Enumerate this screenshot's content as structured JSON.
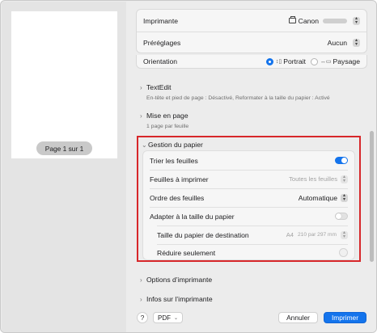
{
  "preview": {
    "page_indicator": "Page 1 sur 1"
  },
  "printer_card": {
    "printer_label": "Imprimante",
    "printer_value": "Canon",
    "presets_label": "Préréglages",
    "presets_value": "Aucun"
  },
  "orientation": {
    "label": "Orientation",
    "portrait": "Portrait",
    "landscape": "Paysage",
    "selected": "Portrait"
  },
  "sections": {
    "textedit": {
      "title": "TextEdit",
      "summary": "En-tête et pied de page : Désactivé, Reformater à la taille du papier : Activé"
    },
    "layout": {
      "title": "Mise en page",
      "summary": "1 page par feuille"
    },
    "paper_handling": {
      "title": "Gestion du papier",
      "collate_label": "Trier les feuilles",
      "collate_on": true,
      "pages_to_print_label": "Feuilles à imprimer",
      "pages_to_print_value": "Toutes les feuilles",
      "page_order_label": "Ordre des feuilles",
      "page_order_value": "Automatique",
      "scale_to_fit_label": "Adapter à la taille du papier",
      "scale_to_fit_on": false,
      "dest_paper_label": "Taille du papier de destination",
      "dest_paper_size": "A4",
      "dest_paper_dims": "210 par 297 mm",
      "scale_down_only_label": "Réduire seulement"
    },
    "printer_options": {
      "title": "Options d’imprimante"
    },
    "printer_info": {
      "title": "Infos sur l’imprimante"
    }
  },
  "footer": {
    "help": "?",
    "pdf": "PDF",
    "cancel": "Annuler",
    "print": "Imprimer"
  },
  "colors": {
    "accent": "#1474ec",
    "highlight_border": "#d7272a"
  }
}
